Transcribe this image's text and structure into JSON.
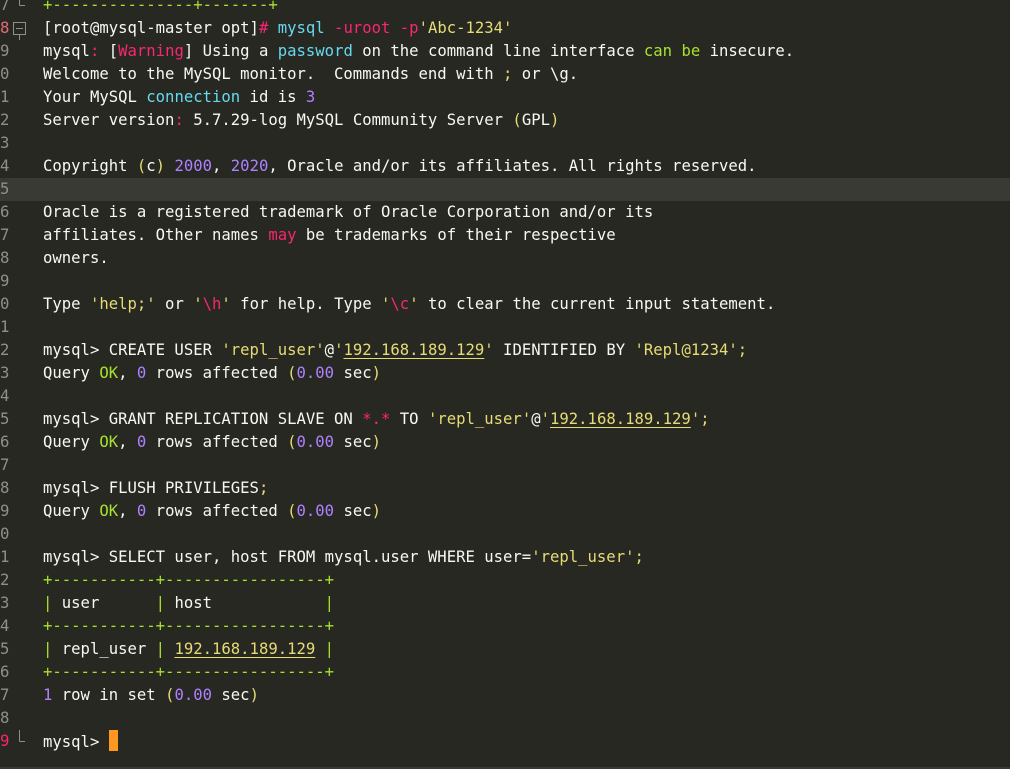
{
  "colors": {
    "background": "#272822",
    "text": "#f8f8f2",
    "keyword": "#f92672",
    "accent_blue": "#66d9ef",
    "number": "#ae81ff",
    "string": "#e6db74",
    "ok_green": "#a6e22e",
    "cursor": "#fd971f"
  },
  "lines": [
    {
      "num": "7",
      "fold": "end",
      "segments": [
        {
          "t": "+---------------+-------+",
          "c": "g"
        }
      ]
    },
    {
      "num": "8",
      "fold": "start",
      "segments": [
        {
          "t": "[root@mysql-master opt]",
          "c": "w"
        },
        {
          "t": "# ",
          "c": "r"
        },
        {
          "t": "mysql",
          "c": "b"
        },
        {
          "t": " -uroot -p",
          "c": "r"
        },
        {
          "t": "'Abc-1234'",
          "c": "y"
        }
      ]
    },
    {
      "num": "9",
      "segments": [
        {
          "t": "mysql",
          "c": "w"
        },
        {
          "t": ": ",
          "c": "r"
        },
        {
          "t": "[",
          "c": "w"
        },
        {
          "t": "Warning",
          "c": "r"
        },
        {
          "t": "]",
          "c": "w"
        },
        {
          "t": " Using a ",
          "c": "w"
        },
        {
          "t": "password",
          "c": "b"
        },
        {
          "t": " on the command line interface ",
          "c": "w"
        },
        {
          "t": "can",
          "c": "g"
        },
        {
          "t": " ",
          "c": "w"
        },
        {
          "t": "be",
          "c": "g"
        },
        {
          "t": " insecure.",
          "c": "w"
        }
      ]
    },
    {
      "num": "0",
      "segments": [
        {
          "t": "Welcome to the MySQL monitor.  Commands end with ",
          "c": "w"
        },
        {
          "t": ";",
          "c": "y"
        },
        {
          "t": " or \\g.",
          "c": "w"
        }
      ]
    },
    {
      "num": "1",
      "segments": [
        {
          "t": "Your MySQL ",
          "c": "w"
        },
        {
          "t": "connection",
          "c": "b"
        },
        {
          "t": " id is ",
          "c": "w"
        },
        {
          "t": "3",
          "c": "p"
        }
      ]
    },
    {
      "num": "2",
      "segments": [
        {
          "t": "Server version",
          "c": "w"
        },
        {
          "t": ":",
          "c": "r"
        },
        {
          "t": " 5.7.29-log MySQL Community Server ",
          "c": "w"
        },
        {
          "t": "(",
          "c": "y"
        },
        {
          "t": "GPL",
          "c": "w"
        },
        {
          "t": ")",
          "c": "y"
        }
      ]
    },
    {
      "num": "3",
      "segments": []
    },
    {
      "num": "4",
      "segments": [
        {
          "t": "Copyright ",
          "c": "w"
        },
        {
          "t": "(",
          "c": "y"
        },
        {
          "t": "c",
          "c": "w"
        },
        {
          "t": ")",
          "c": "y"
        },
        {
          "t": " ",
          "c": "w"
        },
        {
          "t": "2000",
          "c": "p"
        },
        {
          "t": ", ",
          "c": "w"
        },
        {
          "t": "2020",
          "c": "p"
        },
        {
          "t": ", Oracle and/or its affiliates. All rights reserved.",
          "c": "w"
        }
      ]
    },
    {
      "num": "5",
      "hl": true,
      "segments": []
    },
    {
      "num": "6",
      "segments": [
        {
          "t": "Oracle is a registered trademark of Oracle Corporation and/or its",
          "c": "w"
        }
      ]
    },
    {
      "num": "7",
      "segments": [
        {
          "t": "affiliates. Other names ",
          "c": "w"
        },
        {
          "t": "may",
          "c": "r"
        },
        {
          "t": " be trademarks of their respective",
          "c": "w"
        }
      ]
    },
    {
      "num": "8",
      "segments": [
        {
          "t": "owners.",
          "c": "w"
        }
      ]
    },
    {
      "num": "9",
      "segments": []
    },
    {
      "num": "0",
      "segments": [
        {
          "t": "Type ",
          "c": "w"
        },
        {
          "t": "'help;'",
          "c": "y"
        },
        {
          "t": " or ",
          "c": "w"
        },
        {
          "t": "'",
          "c": "y"
        },
        {
          "t": "\\h",
          "c": "r"
        },
        {
          "t": "'",
          "c": "y"
        },
        {
          "t": " for help. Type ",
          "c": "w"
        },
        {
          "t": "'",
          "c": "y"
        },
        {
          "t": "\\c",
          "c": "r"
        },
        {
          "t": "'",
          "c": "y"
        },
        {
          "t": " to clear the current input statement.",
          "c": "w"
        }
      ]
    },
    {
      "num": "1",
      "segments": []
    },
    {
      "num": "2",
      "segments": [
        {
          "t": "mysql> ",
          "c": "w"
        },
        {
          "t": "CREATE USER ",
          "c": "w"
        },
        {
          "t": "'repl_user'",
          "c": "y"
        },
        {
          "t": "@",
          "c": "w"
        },
        {
          "t": "'",
          "c": "y"
        },
        {
          "t": "192.168.189.129",
          "c": "y",
          "u": true
        },
        {
          "t": "'",
          "c": "y"
        },
        {
          "t": " IDENTIFIED BY ",
          "c": "w"
        },
        {
          "t": "'Repl@1234'",
          "c": "y"
        },
        {
          "t": ";",
          "c": "y"
        }
      ]
    },
    {
      "num": "3",
      "segments": [
        {
          "t": "Query ",
          "c": "w"
        },
        {
          "t": "OK",
          "c": "g"
        },
        {
          "t": ", ",
          "c": "w"
        },
        {
          "t": "0",
          "c": "p"
        },
        {
          "t": " rows affected ",
          "c": "w"
        },
        {
          "t": "(",
          "c": "y"
        },
        {
          "t": "0.00",
          "c": "p"
        },
        {
          "t": " sec",
          "c": "w"
        },
        {
          "t": ")",
          "c": "y"
        }
      ]
    },
    {
      "num": "4",
      "segments": []
    },
    {
      "num": "5",
      "segments": [
        {
          "t": "mysql> ",
          "c": "w"
        },
        {
          "t": "GRANT REPLICATION SLAVE ON ",
          "c": "w"
        },
        {
          "t": "*.*",
          "c": "r"
        },
        {
          "t": " TO ",
          "c": "w"
        },
        {
          "t": "'repl_user'",
          "c": "y"
        },
        {
          "t": "@",
          "c": "w"
        },
        {
          "t": "'",
          "c": "y"
        },
        {
          "t": "192.168.189.129",
          "c": "y",
          "u": true
        },
        {
          "t": "'",
          "c": "y"
        },
        {
          "t": ";",
          "c": "y"
        }
      ]
    },
    {
      "num": "6",
      "segments": [
        {
          "t": "Query ",
          "c": "w"
        },
        {
          "t": "OK",
          "c": "g"
        },
        {
          "t": ", ",
          "c": "w"
        },
        {
          "t": "0",
          "c": "p"
        },
        {
          "t": " rows affected ",
          "c": "w"
        },
        {
          "t": "(",
          "c": "y"
        },
        {
          "t": "0.00",
          "c": "p"
        },
        {
          "t": " sec",
          "c": "w"
        },
        {
          "t": ")",
          "c": "y"
        }
      ]
    },
    {
      "num": "7",
      "segments": []
    },
    {
      "num": "8",
      "segments": [
        {
          "t": "mysql> ",
          "c": "w"
        },
        {
          "t": "FLUSH PRIVILEGES",
          "c": "w"
        },
        {
          "t": ";",
          "c": "y"
        }
      ]
    },
    {
      "num": "9",
      "segments": [
        {
          "t": "Query ",
          "c": "w"
        },
        {
          "t": "OK",
          "c": "g"
        },
        {
          "t": ", ",
          "c": "w"
        },
        {
          "t": "0",
          "c": "p"
        },
        {
          "t": " rows affected ",
          "c": "w"
        },
        {
          "t": "(",
          "c": "y"
        },
        {
          "t": "0.00",
          "c": "p"
        },
        {
          "t": " sec",
          "c": "w"
        },
        {
          "t": ")",
          "c": "y"
        }
      ]
    },
    {
      "num": "0",
      "segments": []
    },
    {
      "num": "1",
      "segments": [
        {
          "t": "mysql> ",
          "c": "w"
        },
        {
          "t": "SELECT user, host FROM mysql.user WHERE user=",
          "c": "w"
        },
        {
          "t": "'repl_user'",
          "c": "y"
        },
        {
          "t": ";",
          "c": "y"
        }
      ]
    },
    {
      "num": "2",
      "segments": [
        {
          "t": "+-----------+-----------------+",
          "c": "g"
        }
      ]
    },
    {
      "num": "3",
      "segments": [
        {
          "t": "|",
          "c": "g"
        },
        {
          "t": " user      ",
          "c": "w"
        },
        {
          "t": "|",
          "c": "g"
        },
        {
          "t": " host            ",
          "c": "w"
        },
        {
          "t": "|",
          "c": "g"
        }
      ]
    },
    {
      "num": "4",
      "segments": [
        {
          "t": "+-----------+-----------------+",
          "c": "g"
        }
      ]
    },
    {
      "num": "5",
      "segments": [
        {
          "t": "|",
          "c": "g"
        },
        {
          "t": " repl_user ",
          "c": "w"
        },
        {
          "t": "|",
          "c": "g"
        },
        {
          "t": " ",
          "c": "w"
        },
        {
          "t": "192.168.189.129",
          "c": "y",
          "u": true
        },
        {
          "t": " ",
          "c": "w"
        },
        {
          "t": "|",
          "c": "g"
        }
      ]
    },
    {
      "num": "6",
      "segments": [
        {
          "t": "+-----------+-----------------+",
          "c": "g"
        }
      ]
    },
    {
      "num": "7",
      "segments": [
        {
          "t": "1",
          "c": "p"
        },
        {
          "t": " row in set ",
          "c": "w"
        },
        {
          "t": "(",
          "c": "y"
        },
        {
          "t": "0.00",
          "c": "p"
        },
        {
          "t": " sec",
          "c": "w"
        },
        {
          "t": ")",
          "c": "y"
        }
      ]
    },
    {
      "num": "8",
      "segments": []
    },
    {
      "num": "9",
      "fold": "end",
      "cursor": true,
      "segments": [
        {
          "t": "mysql> ",
          "c": "w"
        }
      ]
    }
  ]
}
